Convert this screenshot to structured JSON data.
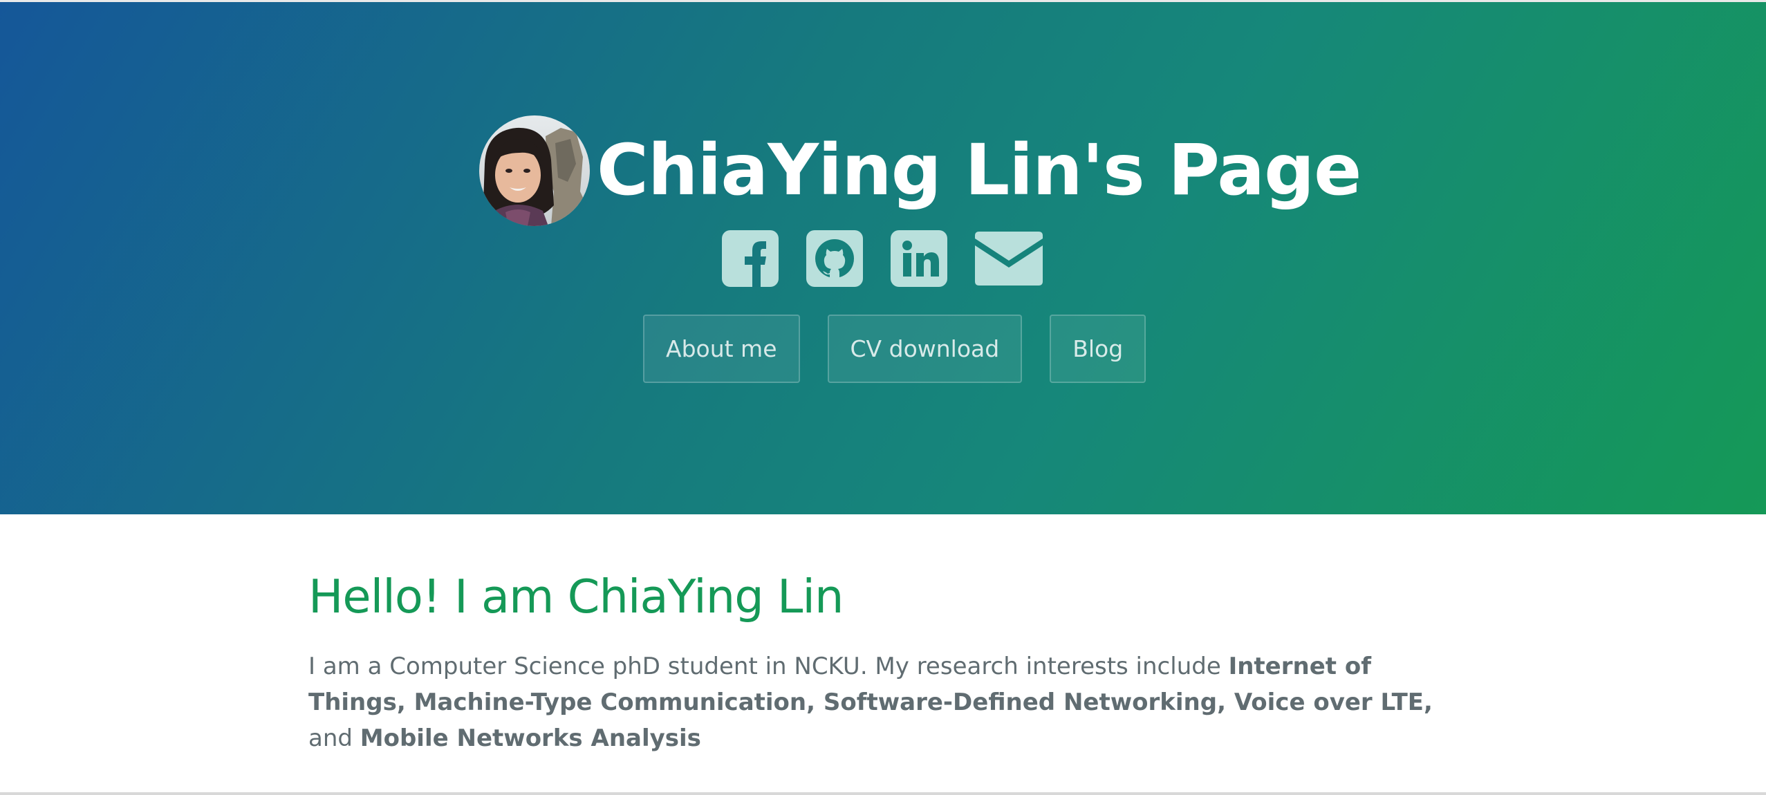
{
  "header": {
    "title": "ChiaYing Lin's Page",
    "avatar_alt": "ChiaYing Lin profile photo"
  },
  "social_links": [
    {
      "name": "Facebook",
      "icon": "facebook-icon"
    },
    {
      "name": "GitHub",
      "icon": "github-icon"
    },
    {
      "name": "LinkedIn",
      "icon": "linkedin-icon"
    },
    {
      "name": "Email",
      "icon": "email-icon"
    }
  ],
  "nav": {
    "about_label": "About me",
    "cv_label": "CV download",
    "blog_label": "Blog"
  },
  "main": {
    "heading": "Hello! I am ChiaYing Lin",
    "intro": {
      "lead": "I am a Computer Science phD student in NCKU. My research interests include ",
      "interests_bold": "Internet of Things, Machine-Type Communication, Software-Defined Networking, Voice over LTE,",
      "conjunction": " and ",
      "last_interest_bold": "Mobile Networks Analysis"
    }
  },
  "colors": {
    "gradient_start": "#155799",
    "gradient_end": "#159957",
    "heading_green": "#159957",
    "body_text": "#606c71",
    "icon_fill": "#b9e0dc"
  }
}
